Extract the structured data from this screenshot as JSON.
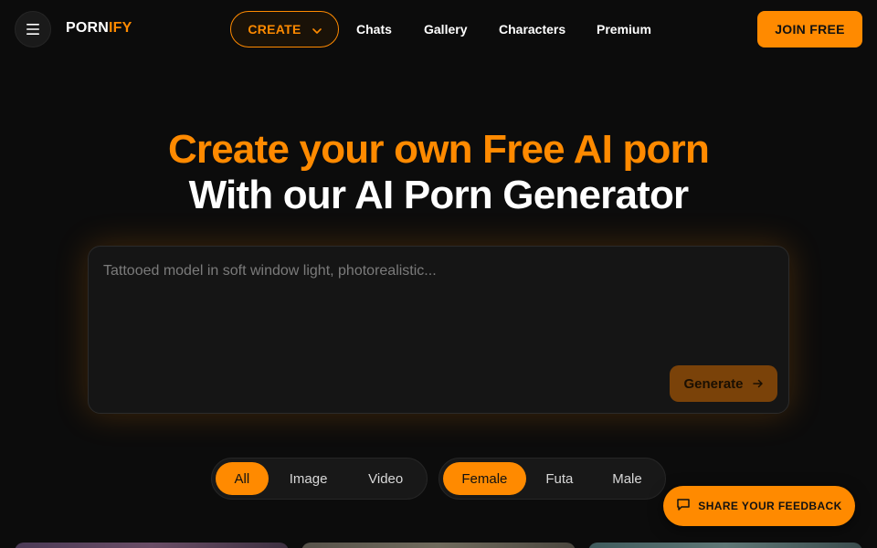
{
  "header": {
    "logo_white": "PORN",
    "logo_orange": "IFY",
    "create_label": "CREATE",
    "nav": [
      "Chats",
      "Gallery",
      "Characters",
      "Premium"
    ],
    "join_label": "JOIN FREE"
  },
  "hero": {
    "line1": "Create your own Free AI porn",
    "line2": "With our AI Porn Generator"
  },
  "prompt": {
    "placeholder": "Tattooed model in soft window light, photorealistic...",
    "value": "",
    "generate_label": "Generate"
  },
  "filters": {
    "media": [
      {
        "label": "All",
        "active": true
      },
      {
        "label": "Image",
        "active": false
      },
      {
        "label": "Video",
        "active": false
      }
    ],
    "gender": [
      {
        "label": "Female",
        "active": true
      },
      {
        "label": "Futa",
        "active": false
      },
      {
        "label": "Male",
        "active": false
      }
    ]
  },
  "feedback": {
    "label": "SHARE YOUR FEEDBACK"
  },
  "colors": {
    "accent": "#ff8a00",
    "background": "#0c0c0c",
    "generate_bg": "#7a4209"
  },
  "icons": {
    "menu": "hamburger-icon",
    "create": "chevron-down-icon",
    "generate": "arrow-right-icon",
    "feedback": "chat-bubble-icon"
  }
}
